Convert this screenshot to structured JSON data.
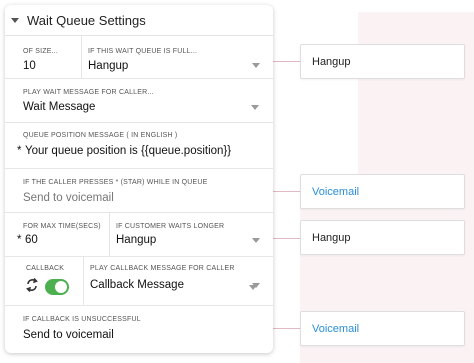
{
  "panel": {
    "title": "Wait Queue Settings"
  },
  "queue_size": {
    "label": "OF SIZE...",
    "value": "10"
  },
  "queue_full": {
    "label": "IF THIS WAIT QUEUE IS FULL...",
    "value": "Hangup"
  },
  "wait_message": {
    "label": "PLAY WAIT MESSAGE FOR CALLER...",
    "value": "Wait Message"
  },
  "position_message": {
    "label": "QUEUE POSITION MESSAGE  ( IN ENGLISH )",
    "required_mark": "*",
    "value": "Your queue position is {{queue.position}}"
  },
  "star_press": {
    "label": "IF THE CALLER PRESSES * (STAR) WHILE IN QUEUE",
    "value": "Send to voicemail"
  },
  "max_time": {
    "label": "FOR MAX TIME(SECS)",
    "required_mark": "*",
    "value": "60"
  },
  "customer_waits": {
    "label": "IF CUSTOMER WAITS LONGER",
    "value": "Hangup"
  },
  "callback": {
    "label": "CALLBACK",
    "enabled": true,
    "toggle_color": "#4caf50"
  },
  "callback_message": {
    "label": "PLAY CALLBACK MESSAGE FOR CALLER",
    "value": "Callback Message"
  },
  "callback_fail": {
    "label": "IF CALLBACK  IS UNSUCCESSFUL",
    "value": "Send to voicemail"
  },
  "side_nodes": [
    {
      "label": "Hangup"
    },
    {
      "label": "Voicemail",
      "color": "#2b8fd6"
    },
    {
      "label": "Hangup"
    },
    {
      "label": "Voicemail",
      "color": "#2b8fd6"
    }
  ]
}
